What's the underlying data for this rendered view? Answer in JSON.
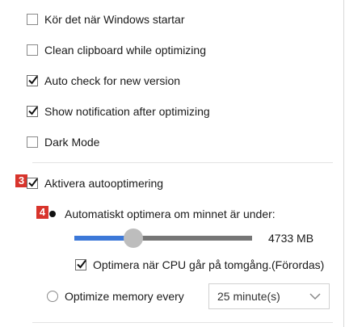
{
  "options": {
    "start_with_windows": {
      "label": "Kör det när Windows startar",
      "checked": false
    },
    "clean_clipboard": {
      "label": "Clean clipboard while optimizing",
      "checked": false
    },
    "auto_check_version": {
      "label": "Auto check for new version",
      "checked": true
    },
    "show_notification": {
      "label": "Show notification after optimizing",
      "checked": true
    },
    "dark_mode": {
      "label": "Dark Mode",
      "checked": false
    }
  },
  "auto_optimize": {
    "badge": "3",
    "label": "Aktivera autooptimering",
    "checked": true
  },
  "memory_threshold": {
    "badge": "4",
    "label": "Automatiskt optimera om minnet är under:",
    "selected": true,
    "slider_fraction": 0.33,
    "value_text": "4733 MB"
  },
  "cpu_idle": {
    "label": "Optimera när CPU går på tomgång.(Förordas)",
    "checked": true
  },
  "interval": {
    "label": "Optimize memory every",
    "selected": false,
    "dropdown_value": "25 minute(s)"
  },
  "colors": {
    "accent": "#3c78d8",
    "badge": "#d8342c"
  }
}
